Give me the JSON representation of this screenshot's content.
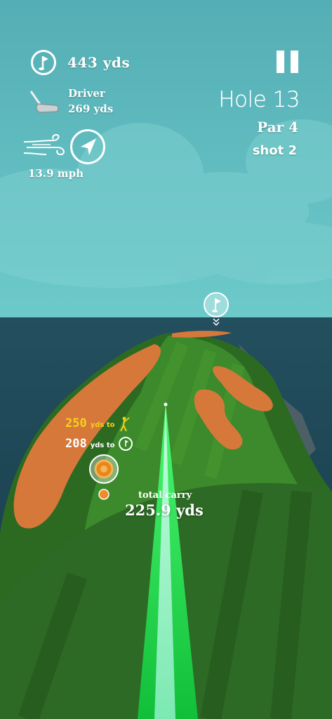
{
  "hud": {
    "distance_to_pin": "443 yds",
    "club_name": "Driver",
    "club_distance": "269 yds",
    "wind_speed": "13.9 mph",
    "hole": "Hole 13",
    "par": "Par 4",
    "shot": "shot 2",
    "pause_icon": "pause-icon",
    "flag_icon": "flag-circle-icon",
    "club_icon": "driver-club-icon",
    "wind_icon": "wind-gust-icon",
    "wind_direction_icon": "wind-arrow-icon"
  },
  "course": {
    "marker_golfer_value": "250",
    "marker_golfer_suffix": "yds to",
    "marker_pin_value": "208",
    "marker_pin_suffix": "yds to",
    "carry_label": "total carry",
    "carry_value": "225.9 yds",
    "pin_marker_icon": "pin-flag-marker-icon",
    "golfer_icon": "golfer-icon",
    "target_icon": "landing-target-icon"
  },
  "colors": {
    "sky_top": "#5fb9bf",
    "sky_bottom": "#6ac8c8",
    "sea": "#1e4b5c",
    "rough": "#2f6a22",
    "fairway": "#3e8d2c",
    "sand": "#d7793c",
    "aim_green": "#22e04a",
    "yellow_text": "#f3d21a"
  }
}
